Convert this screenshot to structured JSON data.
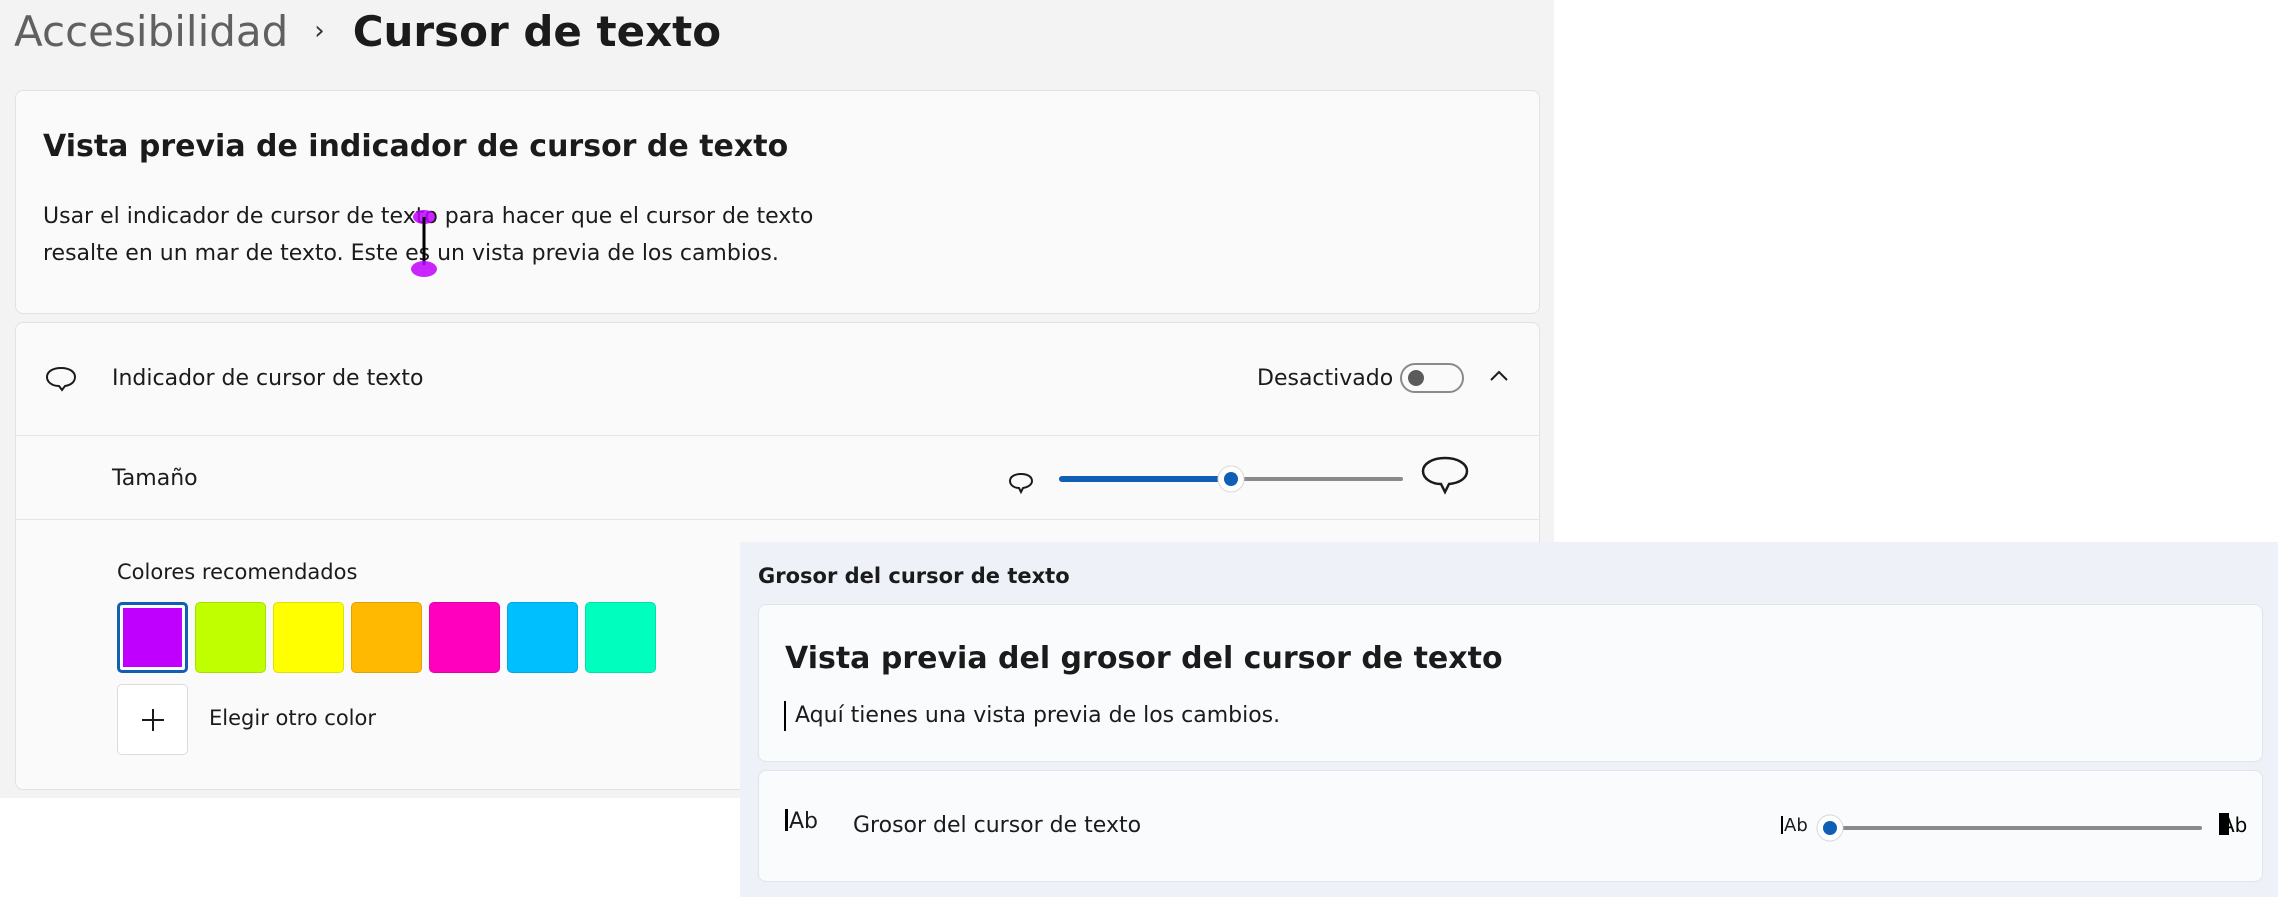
{
  "breadcrumb": {
    "parent": "Accesibilidad",
    "separator": "›",
    "current": "Cursor de texto"
  },
  "indicator_preview": {
    "title": "Vista previa de indicador de cursor de texto",
    "line1": "Usar el indicador de cursor de texto para hacer que el cursor de texto",
    "line2": "resalte en un mar de texto. Este es un vista previa de los cambios."
  },
  "indicator_setting": {
    "label": "Indicador de cursor de texto",
    "state_text": "Desactivado",
    "toggle_on": false,
    "expanded": true,
    "icon": "speech-bubble-icon"
  },
  "size_setting": {
    "label": "Tamaño",
    "value_fraction": 0.5
  },
  "colors": {
    "label": "Colores recomendados",
    "swatches": [
      "#c000ff",
      "#bfff00",
      "#ffff00",
      "#ffb900",
      "#ff00bf",
      "#00bfff",
      "#00ffbf"
    ],
    "selected_index": 0,
    "custom_label": "Elegir otro color"
  },
  "thickness": {
    "heading": "Grosor del cursor de texto",
    "preview_title": "Vista previa del grosor del cursor de texto",
    "preview_text": "Aquí tienes una vista previa de los cambios.",
    "setting_label": "Grosor del cursor de texto",
    "icon_text": "Ab",
    "value_fraction": 0
  },
  "colors_accent": {
    "slider_blue": "#0f5fb5",
    "marker_purple": "#c000ff"
  }
}
